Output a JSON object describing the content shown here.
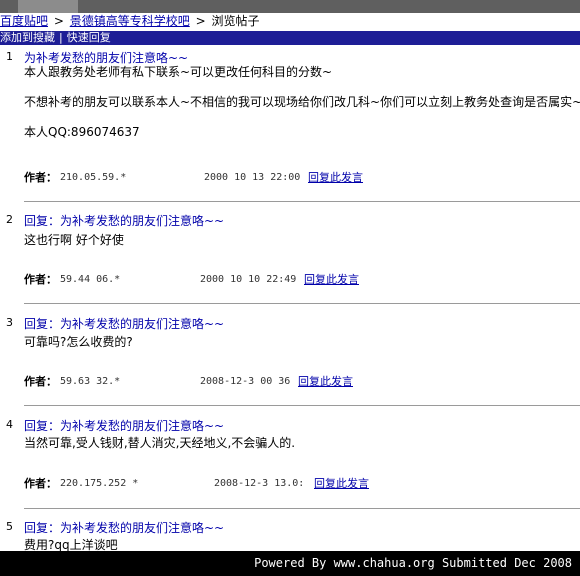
{
  "breadcrumb": {
    "home": "百度贴吧",
    "forum": "景德镇高等专科学校吧",
    "current": "浏览帖子",
    "sep": ">"
  },
  "toolbar": {
    "search": "添加到搜藏",
    "sep": "|",
    "quick_reply": "快速回复"
  },
  "posts": [
    {
      "num": "1",
      "title": "为补考发愁的朋友们注意咯~~",
      "lines": [
        "本人跟教务处老师有私下联系~可以更改任何科目的分数~",
        "不想补考的朋友可以联系本人~不相信的我可以现场给你们改几科~你们可以立刻上教务处查询是否属实~",
        "本人QQ:896074637"
      ],
      "author_label": "作者：",
      "ip": "210.05.59.*",
      "time": "2000 10 13 22:00",
      "reply": "回复此发言"
    },
    {
      "num": "2",
      "title": "回复：为补考发愁的朋友们注意咯~~",
      "lines": [
        "这也行啊 好个好使"
      ],
      "author_label": "作者：",
      "ip": "59.44 06.*",
      "time": "2000 10 10 22:49",
      "reply": "回复此发言"
    },
    {
      "num": "3",
      "title": "回复：为补考发愁的朋友们注意咯~~",
      "lines": [
        "可靠吗?怎么收费的?"
      ],
      "author_label": "作者：",
      "ip": "59.63 32.*",
      "time": "2008-12-3 00 36",
      "reply": "回复此发言"
    },
    {
      "num": "4",
      "title": "回复：为补考发愁的朋友们注意咯~~",
      "lines": [
        "当然可靠,受人钱财,替人消灾,天经地义,不会骗人的."
      ],
      "author_label": "作者：",
      "ip": "220.175.252 *",
      "time": "2008-12-3 13.0:",
      "reply": "回复此发言"
    },
    {
      "num": "5",
      "title": "回复：为补考发愁的朋友们注意咯~~",
      "lines": [
        "费用?qq上洋谈吧"
      ]
    }
  ],
  "footer": "Powered By www.chahua.org  Submitted Dec 2008"
}
